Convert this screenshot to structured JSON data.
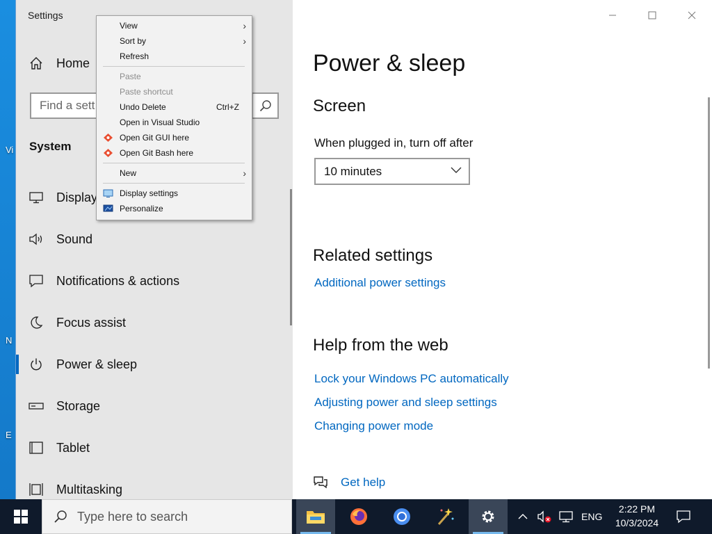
{
  "desktop": {
    "fragments": [
      "Vi",
      "N",
      "E"
    ]
  },
  "window": {
    "title": "Settings",
    "minimize_icon": "minimize-icon",
    "maximize_icon": "maximize-icon",
    "close_icon": "close-icon"
  },
  "sidebar": {
    "home_label": "Home",
    "search_placeholder": "Find a setting",
    "search_visible_text": "Find a sett",
    "section_title": "System",
    "items": [
      {
        "label": "Display",
        "icon": "monitor-icon",
        "active": false
      },
      {
        "label": "Sound",
        "icon": "speaker-icon",
        "active": false
      },
      {
        "label": "Notifications & actions",
        "icon": "notification-icon",
        "active": false
      },
      {
        "label": "Focus assist",
        "icon": "moon-icon",
        "active": false
      },
      {
        "label": "Power & sleep",
        "icon": "power-icon",
        "active": true
      },
      {
        "label": "Storage",
        "icon": "storage-icon",
        "active": false
      },
      {
        "label": "Tablet",
        "icon": "tablet-icon",
        "active": false
      },
      {
        "label": "Multitasking",
        "icon": "multitasking-icon",
        "active": false
      }
    ]
  },
  "main": {
    "title": "Power & sleep",
    "screen_heading": "Screen",
    "plugged_label": "When plugged in, turn off after",
    "plugged_value": "10 minutes",
    "related_heading": "Related settings",
    "related_link": "Additional power settings",
    "help_heading": "Help from the web",
    "help_links": [
      "Lock your Windows PC automatically",
      "Adjusting power and sleep settings",
      "Changing power mode"
    ],
    "get_help": "Get help"
  },
  "context_menu": {
    "view": "View",
    "sort_by": "Sort by",
    "refresh": "Refresh",
    "paste": "Paste",
    "paste_shortcut": "Paste shortcut",
    "undo_delete": "Undo Delete",
    "undo_shortcut": "Ctrl+Z",
    "open_vs": "Open in Visual Studio",
    "git_gui": "Open Git GUI here",
    "git_bash": "Open Git Bash here",
    "new": "New",
    "display_settings": "Display settings",
    "personalize": "Personalize"
  },
  "taskbar": {
    "search_placeholder": "Type here to search",
    "language": "ENG",
    "time": "2:22 PM",
    "date": "10/3/2024",
    "apps": [
      "file-explorer-icon",
      "firefox-icon",
      "chromium-icon",
      "magic-wand-icon",
      "settings-gear-icon"
    ]
  },
  "colors": {
    "accent": "#0067c0",
    "taskbar": "#0f1a2b",
    "sidebar": "#e6e6e6",
    "desktop": "#1a8ee0"
  }
}
